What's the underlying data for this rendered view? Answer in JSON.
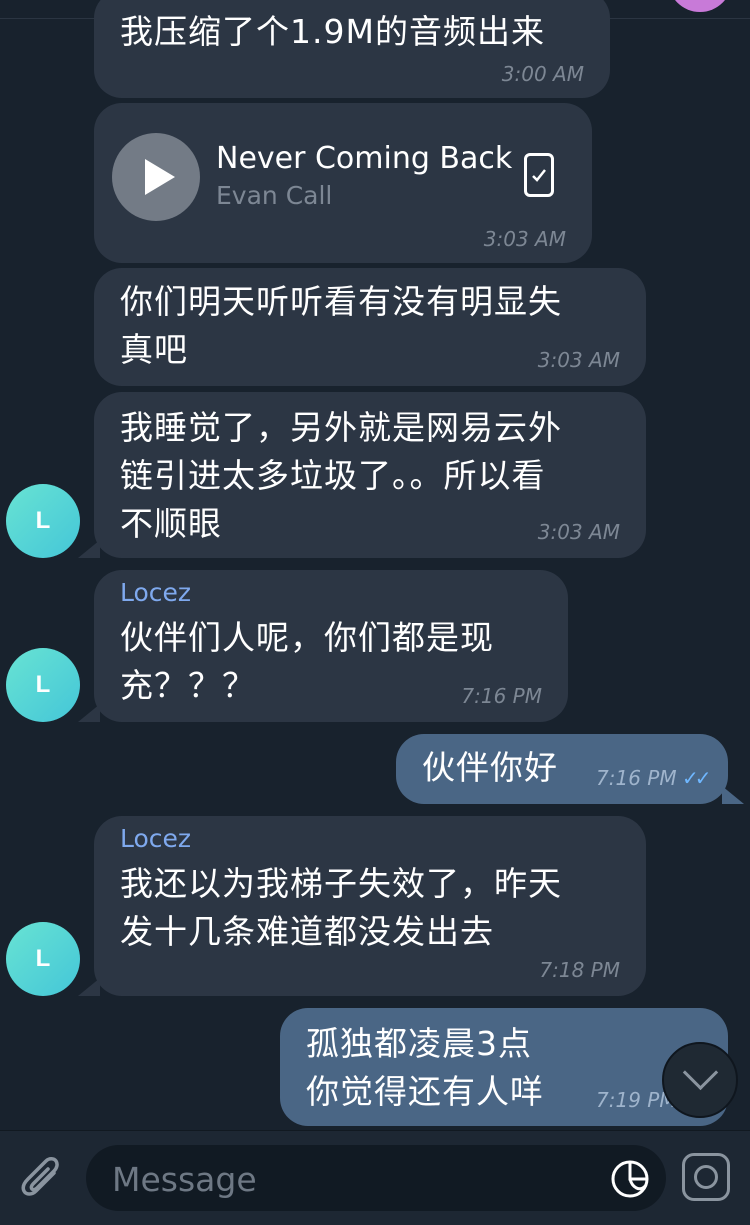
{
  "messages": {
    "m1": {
      "text": "我压缩了个1.9M的音频出来",
      "time": "3:00 AM"
    },
    "m2": {
      "track": "Never Coming Back",
      "artist": "Evan Call",
      "time": "3:03 AM"
    },
    "m3": {
      "text": "你们明天听听看有没有明显失\n真吧",
      "time": "3:03 AM"
    },
    "m4": {
      "text": "我睡觉了，另外就是网易云外\n链引进太多垃圾了。。所以看\n不顺眼",
      "time": "3:03 AM"
    },
    "m5": {
      "sender": "Locez",
      "text": "伙伴们人呢，你们都是现\n充？？？",
      "time": "7:16 PM"
    },
    "m6": {
      "text": "伙伴你好",
      "time": "7:16 PM",
      "status": "✓✓"
    },
    "m7": {
      "sender": "Locez",
      "text": "我还以为我梯子失效了，昨天\n发十几条难道都没发出去",
      "time": "7:18 PM"
    },
    "m8": {
      "text": "孤独都凌晨3点\n你觉得还有人咩",
      "time": "7:19 PM"
    }
  },
  "avatar_initial": "L",
  "composer": {
    "placeholder": "Message"
  },
  "icons": {
    "attach": "paperclip-icon",
    "sticker": "sticker-icon",
    "camera": "camera-icon",
    "scroll": "chevron-down-icon",
    "play": "play-icon",
    "file": "phone-file-icon"
  },
  "colors": {
    "background": "#18222d",
    "incoming_bubble": "#2c3644",
    "outgoing_bubble": "#4a6685",
    "sender_name": "#7fa9ee",
    "avatar": "#55d3d6"
  }
}
